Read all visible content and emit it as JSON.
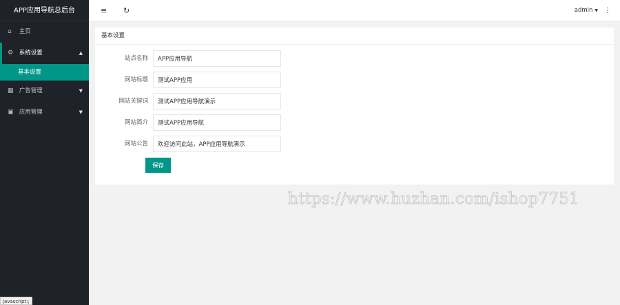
{
  "sidebar": {
    "logo": "APP应用导航总后台",
    "items": [
      {
        "icon": "home-icon",
        "glyph": "⌂",
        "label": "主页"
      },
      {
        "icon": "gear-icon",
        "glyph": "⚙",
        "label": "系统设置"
      },
      {
        "icon": "chart-icon",
        "glyph": "▦",
        "label": "广告管理"
      },
      {
        "icon": "app-icon",
        "glyph": "▣",
        "label": "应用管理"
      }
    ],
    "sub_items": [
      {
        "label": "基本设置"
      }
    ],
    "status_tip": "javascript:;"
  },
  "header": {
    "user": "admin",
    "menu_icon": "≡",
    "refresh_icon": "↻",
    "more_icon": "⋮"
  },
  "card": {
    "title": "基本设置",
    "fields": [
      {
        "label": "站点名称",
        "value": "APP应用导航"
      },
      {
        "label": "网站标题",
        "value": "测试APP应用"
      },
      {
        "label": "网站关键词",
        "value": "测试APP应用导航演示"
      },
      {
        "label": "网站简介",
        "value": "测试APP应用导航"
      },
      {
        "label": "网站公告",
        "value": "欢迎访问此站，APP应用导航演示"
      }
    ],
    "save_label": "保存"
  },
  "watermark": "https://www.huzhan.com/ishop7751",
  "colors": {
    "accent": "#009688",
    "sidebar_bg": "#20222a"
  }
}
